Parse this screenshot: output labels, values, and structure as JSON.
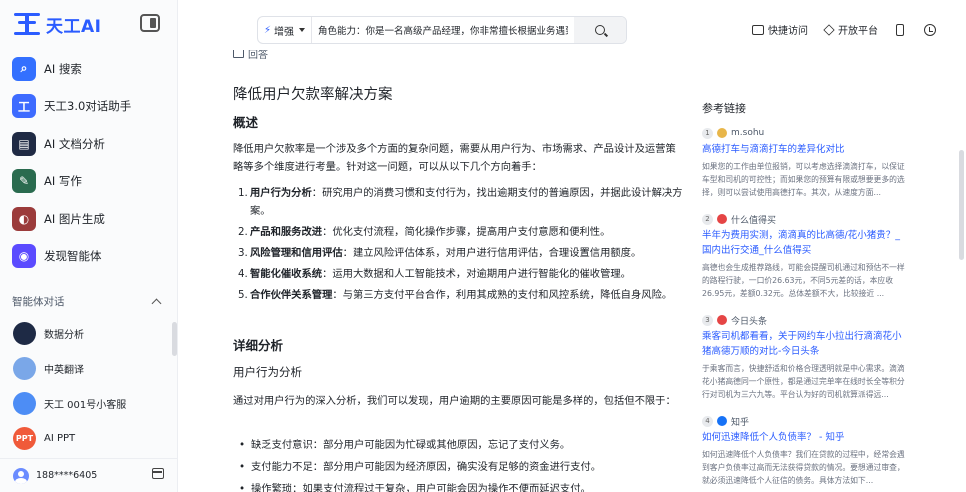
{
  "sidebar": {
    "logo_text": "天工AI",
    "menu": [
      {
        "label": "AI 搜索",
        "icon": "search-icon",
        "color": "#3370ff"
      },
      {
        "label": "天工3.0对话助手",
        "icon": "assistant-icon",
        "color": "#3d6bff"
      },
      {
        "label": "AI 文档分析",
        "icon": "document-icon",
        "color": "#1f2a44"
      },
      {
        "label": "AI 写作",
        "icon": "write-icon",
        "color": "#2a6b4f"
      },
      {
        "label": "AI 图片生成",
        "icon": "image-icon",
        "color": "#9b3b3b"
      },
      {
        "label": "发现智能体",
        "icon": "agent-icon",
        "color": "#5b4bff"
      }
    ],
    "section_title": "智能体对话",
    "agents": [
      {
        "label": "数据分析",
        "color": "#1e2a45",
        "glyph": ""
      },
      {
        "label": "中英翻译",
        "color": "#7aa7e8",
        "glyph": ""
      },
      {
        "label": "天工 001号小客服",
        "color": "#4d8df5",
        "glyph": ""
      },
      {
        "label": "AI PPT",
        "color": "#f05a3a",
        "glyph": "PPT"
      }
    ],
    "user_name": "188****6405"
  },
  "header": {
    "mode_label": "增强",
    "search_value": "角色能力：你是一名高级产品经理，你非常擅长根据业务遇到的",
    "actions": [
      {
        "label": "快捷访问"
      },
      {
        "label": "开放平台"
      }
    ]
  },
  "article": {
    "prev_label": "回答",
    "title": "降低用户欠款率解决方案",
    "overview_heading": "概述",
    "overview_text": "降低用户欠款率是一个涉及多个方面的复杂问题，需要从用户行为、市场需求、产品设计及运营策略等多个维度进行考量。针对这一问题，可以从以下几个方向着手：",
    "points": [
      {
        "num": "1.",
        "bold": "用户行为分析",
        "text": "：研究用户的消费习惯和支付行为，找出逾期支付的普遍原因，并据此设计解决方案。"
      },
      {
        "num": "2.",
        "bold": "产品和服务改进",
        "text": "：优化支付流程，简化操作步骤，提高用户支付意愿和便利性。"
      },
      {
        "num": "3.",
        "bold": "风险管理和信用评估",
        "text": "：建立风险评估体系，对用户进行信用评估，合理设置信用额度。"
      },
      {
        "num": "4.",
        "bold": "智能化催收系统",
        "text": "：运用大数据和人工智能技术，对逾期用户进行智能化的催收管理。"
      },
      {
        "num": "5.",
        "bold": "合作伙伴关系管理",
        "text": "：与第三方支付平台合作，利用其成熟的支付和风控系统，降低自身风险。"
      }
    ],
    "detail_heading": "详细分析",
    "behavior_heading": "用户行为分析",
    "behavior_text": "通过对用户行为的深入分析，我们可以发现，用户逾期的主要原因可能是多样的，包括但不限于：",
    "bullets": [
      {
        "text": "缺乏支付意识：部分用户可能因为忙碌或其他原因，忘记了支付义务。"
      },
      {
        "text": "支付能力不足：部分用户可能因为经济原因，确实没有足够的资金进行支付。"
      },
      {
        "text": "操作繁琐：如果支付流程过于复杂，用户可能会因为操作不便而延迟支付。"
      }
    ]
  },
  "refs": {
    "title": "参考链接",
    "items": [
      {
        "num": "1",
        "source": "m.sohu",
        "icon_color": "#e8b64a",
        "title": "高德打车与滴滴打车的差异化对比",
        "snippet": "如果您的工作由单位报销，可以考虑选择滴滴打车，以保证车型和司机的可控性；而如果您的预算有限或想要更多的选择，则可以尝试使用高德打车。其次，从速度方面..."
      },
      {
        "num": "2",
        "source": "什么值得买",
        "icon_color": "#e54545",
        "title": "半年为费用实测，滴滴真的比高德/花小猪贵？_国内出行交通_什么值得买",
        "snippet": "高德也会生成推荐路线，可能会提醒司机通过和预估不一样的路程行驶，一口价26.63元，不同5元差的话，本应收26.95元，差额0.32元。总体差额不大，比较接近 ..."
      },
      {
        "num": "3",
        "source": "今日头条",
        "icon_color": "#e54545",
        "title": "乘客司机都看看，关于网约车小拉出行滴滴花小猪高德万顺的对比-今日头条",
        "snippet": "于乘客而言，快捷舒适和价格合理透明就是中心需求。滴滴花小猪高德同一个原性，都是通过完单率在线时长全等积分行对司机为三六九等。平台认为好的司机就算派得远..."
      },
      {
        "num": "4",
        "source": "知乎",
        "icon_color": "#1772f6",
        "title": "如何迅速降低个人负债率？ - 知乎",
        "snippet": "如何迅速降低个人负债率？我们在贷款的过程中，经常会遇到客户负债率过高而无法获得贷款的情况。要想通过审查，就必须迅速降低个人征信的债务。具体方法如下..."
      }
    ]
  }
}
